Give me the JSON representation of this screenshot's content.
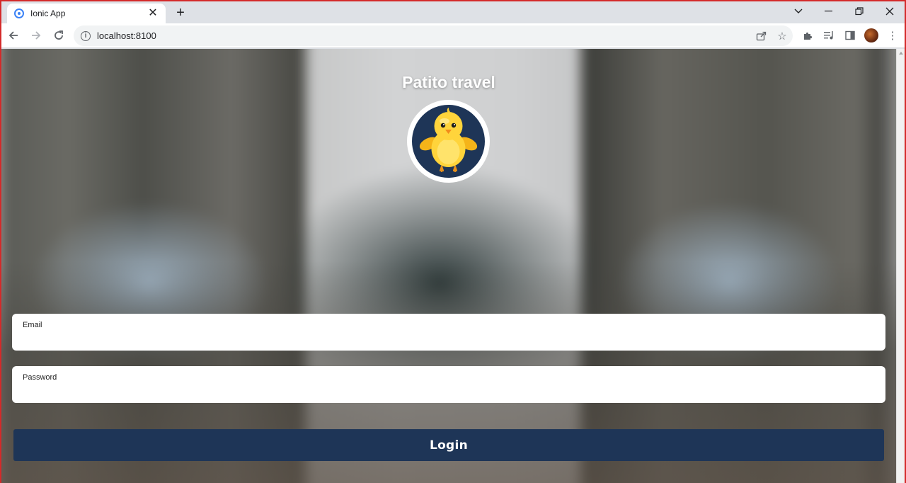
{
  "browser": {
    "tab": {
      "title": "Ionic App",
      "close": "✕",
      "favicon": "ionic-favicon-icon"
    },
    "new_tab": "+",
    "window_controls": {
      "chevron": "⌄",
      "minimize": "—",
      "restore": "❐",
      "close": "✕"
    },
    "nav": {
      "back": "←",
      "forward": "→",
      "reload": "↻"
    },
    "address": {
      "url": "localhost:8100",
      "info": "i"
    },
    "omni_icons": {
      "share": "⇪",
      "bookmark": "☆"
    },
    "tools": {
      "extensions": "✱",
      "media": "≡",
      "sidepanel": "▮",
      "menu": "⋮"
    }
  },
  "page": {
    "title": "Patito travel",
    "logo": "chick-logo",
    "email": {
      "label": "Email",
      "value": ""
    },
    "password": {
      "label": "Password",
      "value": ""
    },
    "login_label": "Login"
  },
  "colors": {
    "primary": "#1e3557",
    "window_border": "#d42a2a"
  }
}
